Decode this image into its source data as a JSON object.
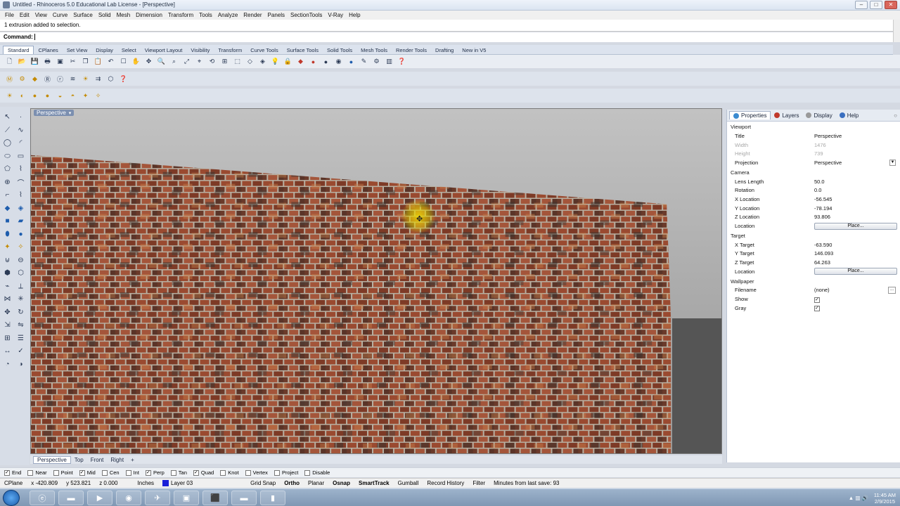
{
  "window": {
    "title": "Untitled - Rhinoceros 5.0 Educational Lab License - [Perspective]",
    "buttons": {
      "minimize": "–",
      "maximize": "□",
      "close": "✕"
    }
  },
  "menu": [
    "File",
    "Edit",
    "View",
    "Curve",
    "Surface",
    "Solid",
    "Mesh",
    "Dimension",
    "Transform",
    "Tools",
    "Analyze",
    "Render",
    "Panels",
    "SectionTools",
    "V-Ray",
    "Help"
  ],
  "history": {
    "text": "1 extrusion added to selection."
  },
  "command": {
    "label": "Command:"
  },
  "toolbar_tabs": [
    "Standard",
    "CPlanes",
    "Set View",
    "Display",
    "Select",
    "Viewport Layout",
    "Visibility",
    "Transform",
    "Curve Tools",
    "Surface Tools",
    "Solid Tools",
    "Mesh Tools",
    "Render Tools",
    "Drafting",
    "New in V5"
  ],
  "toolbar_tabs_active": 0,
  "viewport": {
    "label": "Perspective",
    "dropdown": "▾"
  },
  "viewport_tabs": [
    "Perspective",
    "Top",
    "Front",
    "Right"
  ],
  "viewport_tab_add": "+",
  "panel": {
    "tabs": [
      "Properties",
      "Layers",
      "Display",
      "Help"
    ],
    "tab_colors": [
      "#3a8ad0",
      "#c0392b",
      "#9a9a9a",
      "#3a6fc0"
    ],
    "sections": {
      "viewport": "Viewport",
      "camera": "Camera",
      "target": "Target",
      "wallpaper": "Wallpaper"
    },
    "viewport_props": {
      "title_k": "Title",
      "title_v": "Perspective",
      "width_k": "Width",
      "width_v": "1476",
      "height_k": "Height",
      "height_v": "739",
      "projection_k": "Projection",
      "projection_v": "Perspective"
    },
    "camera_props": {
      "lens_k": "Lens Length",
      "lens_v": "50.0",
      "rotation_k": "Rotation",
      "rotation_v": "0.0",
      "x_k": "X Location",
      "x_v": "-56.545",
      "y_k": "Y Location",
      "y_v": "-78.194",
      "z_k": "Z Location",
      "z_v": "93.806",
      "loc_k": "Location",
      "loc_btn": "Place..."
    },
    "target_props": {
      "x_k": "X Target",
      "x_v": "-63.590",
      "y_k": "Y Target",
      "y_v": "146.093",
      "z_k": "Z Target",
      "z_v": "64.263",
      "loc_k": "Location",
      "loc_btn": "Place..."
    },
    "wallpaper_props": {
      "file_k": "Filename",
      "file_v": "(none)",
      "show_k": "Show",
      "gray_k": "Gray",
      "browse": "..."
    }
  },
  "osnaps": [
    {
      "label": "End",
      "checked": true
    },
    {
      "label": "Near",
      "checked": false
    },
    {
      "label": "Point",
      "checked": false
    },
    {
      "label": "Mid",
      "checked": true
    },
    {
      "label": "Cen",
      "checked": false
    },
    {
      "label": "Int",
      "checked": false
    },
    {
      "label": "Perp",
      "checked": true
    },
    {
      "label": "Tan",
      "checked": false
    },
    {
      "label": "Quad",
      "checked": true
    },
    {
      "label": "Knot",
      "checked": false
    },
    {
      "label": "Vertex",
      "checked": false
    },
    {
      "label": "Project",
      "checked": false
    },
    {
      "label": "Disable",
      "checked": false
    }
  ],
  "status": {
    "cplane": "CPlane",
    "x": "x -420.809",
    "y": "y 523.821",
    "z": "z 0.000",
    "units": "Inches",
    "layer": "Layer 03",
    "layer_color": "#1a20d8",
    "toggles": [
      {
        "label": "Grid Snap",
        "bold": false
      },
      {
        "label": "Ortho",
        "bold": true
      },
      {
        "label": "Planar",
        "bold": false
      },
      {
        "label": "Osnap",
        "bold": true
      },
      {
        "label": "SmartTrack",
        "bold": true
      },
      {
        "label": "Gumball",
        "bold": false
      },
      {
        "label": "Record History",
        "bold": false
      },
      {
        "label": "Filter",
        "bold": false
      }
    ],
    "save_info": "Minutes from last save: 93"
  },
  "taskbar": {
    "apps": [
      "ie-icon",
      "folder-icon",
      "media-player-icon",
      "chrome-icon",
      "rhino-icon",
      "window-icon",
      "vray-icon",
      "folder-icon",
      "mouse-icon"
    ],
    "time": "11:45 AM",
    "date": "2/9/2015"
  }
}
